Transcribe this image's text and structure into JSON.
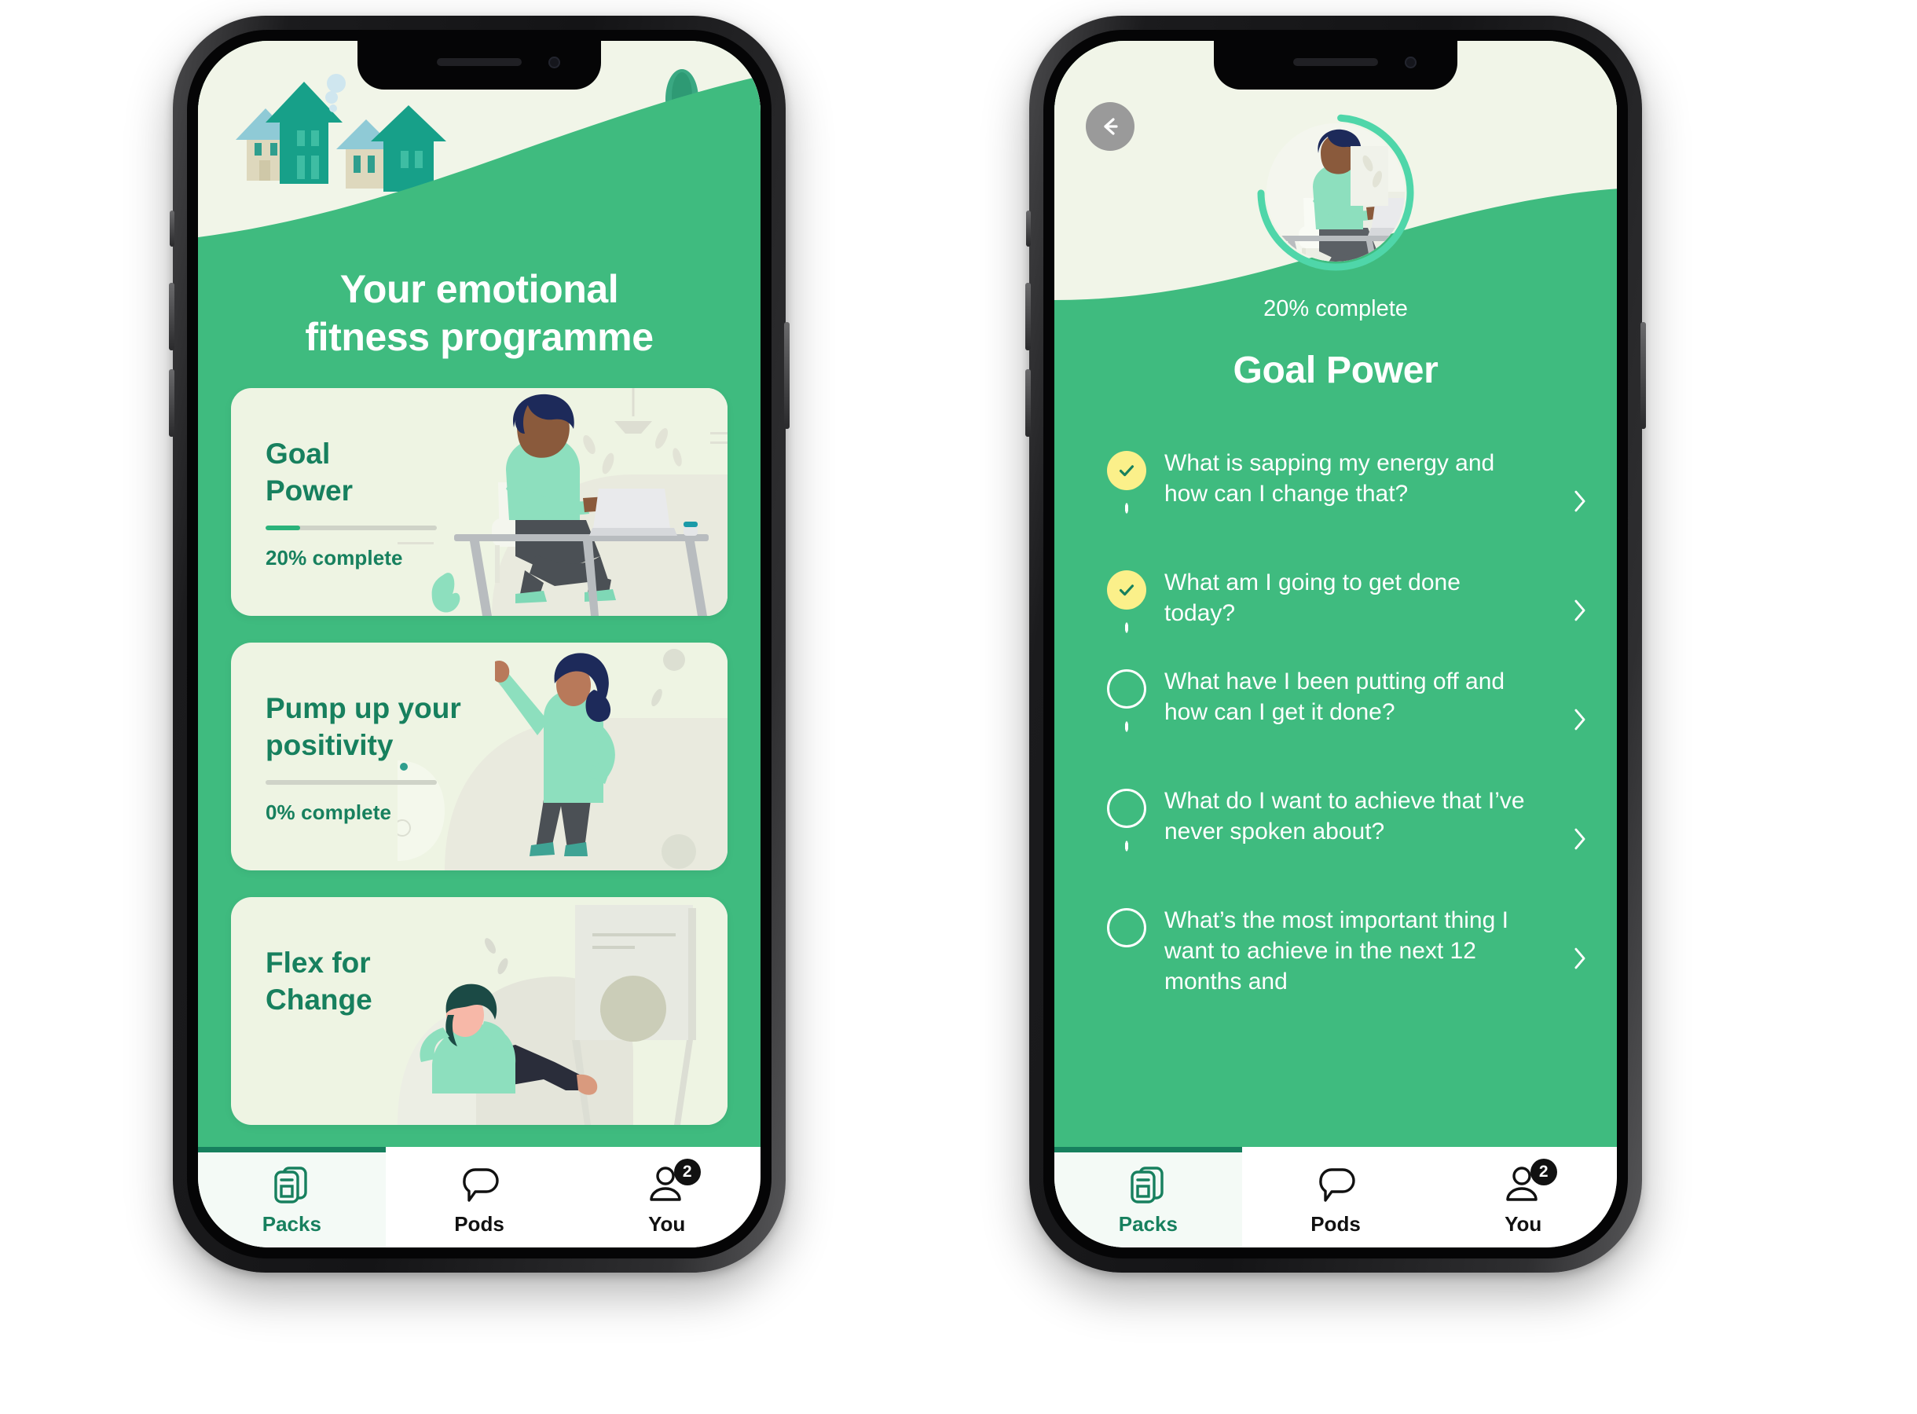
{
  "app": {
    "accent_green": "#3fbb7f",
    "deep_green": "#17805e",
    "cream": "#f1f5e8",
    "card_bg": "#eef4e3",
    "yellow": "#fbf08a"
  },
  "left_screen": {
    "headline_line1": "Your emotional",
    "headline_line2": "fitness programme",
    "cards": [
      {
        "title_line1": "Goal",
        "title_line2": "Power",
        "progress_label": "20% complete",
        "progress_value": 20,
        "art": "person-at-desk-laptop"
      },
      {
        "title_line1": "Pump up your",
        "title_line2": "positivity",
        "progress_label": "0% complete",
        "progress_value": 0,
        "art": "woman-arm-raised"
      },
      {
        "title_line1": "Flex for",
        "title_line2": "Change",
        "progress_label": "",
        "progress_value": 0,
        "art": "woman-relaxing-flipchart"
      }
    ]
  },
  "right_screen": {
    "back_icon": "arrow-left-icon",
    "progress_label": "20% complete",
    "progress_value": 20,
    "title": "Goal Power",
    "questions": [
      {
        "text": "What is sapping my energy and how can I change that?",
        "state": "done"
      },
      {
        "text": "What am I going to get done today?",
        "state": "done"
      },
      {
        "text": "What have I been putting off and how can I get it done?",
        "state": "todo"
      },
      {
        "text": "What do I want to achieve that I’ve never spoken about?",
        "state": "todo"
      },
      {
        "text": "What’s the most important thing I want to achieve in the next 12 months and",
        "state": "todo"
      }
    ]
  },
  "tabbar": {
    "tabs": [
      {
        "label": "Packs",
        "icon": "packs-icon",
        "active": true,
        "badge": ""
      },
      {
        "label": "Pods",
        "icon": "chat-bubble-icon",
        "active": false,
        "badge": ""
      },
      {
        "label": "You",
        "icon": "person-icon",
        "active": false,
        "badge": "2"
      }
    ]
  }
}
